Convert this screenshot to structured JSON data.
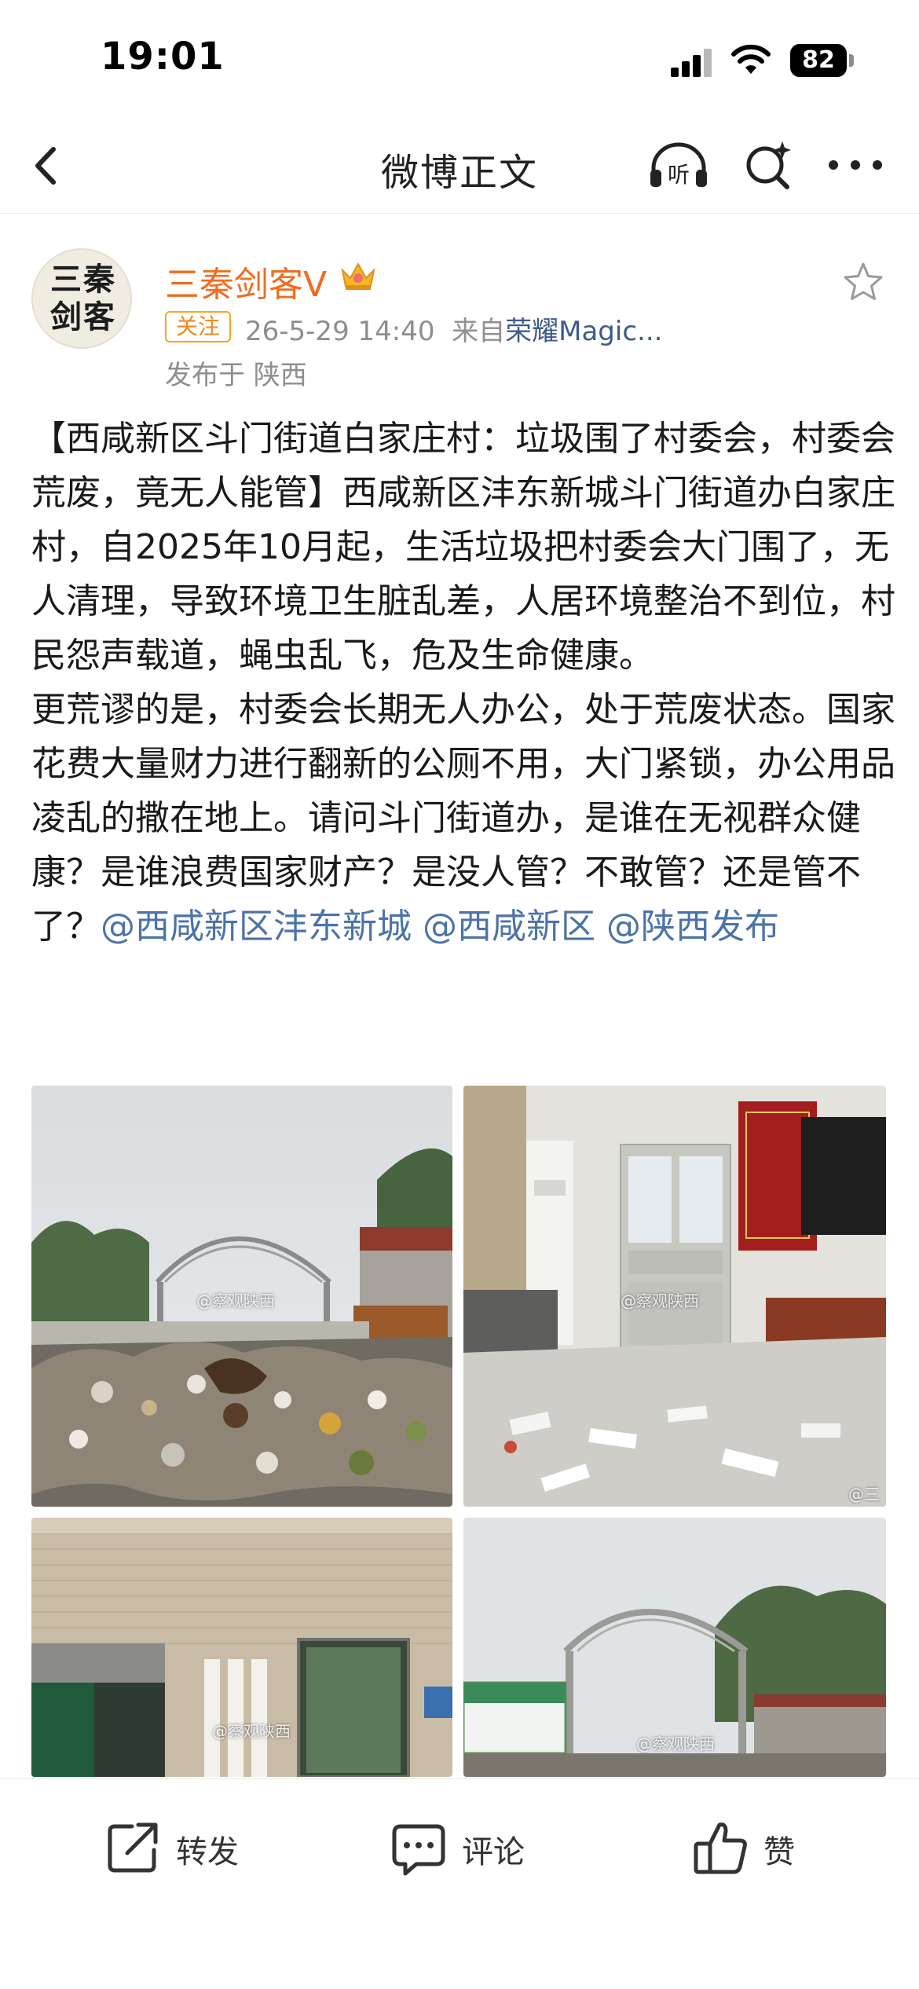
{
  "status_bar": {
    "time": "19:01",
    "battery": "82"
  },
  "nav": {
    "title": "微博正文",
    "icons": [
      "chevron-left-icon",
      "headphones-listen-icon",
      "search-ai-icon",
      "more-icon"
    ]
  },
  "post": {
    "author": {
      "name": "三秦剑客V",
      "avatar_text": "三秦\n剑客",
      "follow_label": "关注"
    },
    "meta": {
      "date": "26-5-29 14:40",
      "source_prefix": "来自",
      "source": "荣耀Magic...",
      "location": "发布于 陕西"
    },
    "paragraph_1": "【西咸新区斗门街道白家庄村：垃圾围了村委会，村委会荒废，竟无人能管】西咸新区沣东新城斗门街道办白家庄村，自2025年10月起，生活垃圾把村委会大门围了，无人清理，导致环境卫生脏乱差，人居环境整治不到位，村民怨声载道，蝇虫乱飞，危及生命健康。",
    "paragraph_2": "更荒谬的是，村委会长期无人办公，处于荒废状态。国家花费大量财力进行翻新的公厕不用，大门紧锁，办公用品凌乱的撒在地上。请问斗门街道办，是谁在无视群众健康？是谁浪费国家财产？是没人管？不敢管？还是管不了？",
    "mentions": [
      "@西咸新区沣东新城",
      "@西咸新区",
      "@陕西发布"
    ],
    "photo_watermark": "@察观陕西",
    "photo_watermark_corner": "@三"
  },
  "actions": {
    "repost_label": "转发",
    "comment_label": "评论",
    "like_label": "赞"
  },
  "colors": {
    "author_name": "#f06d1f",
    "mention": "#4b73a8",
    "follow_badge": "#f5a623",
    "meta_gray": "#8e8e8e"
  }
}
